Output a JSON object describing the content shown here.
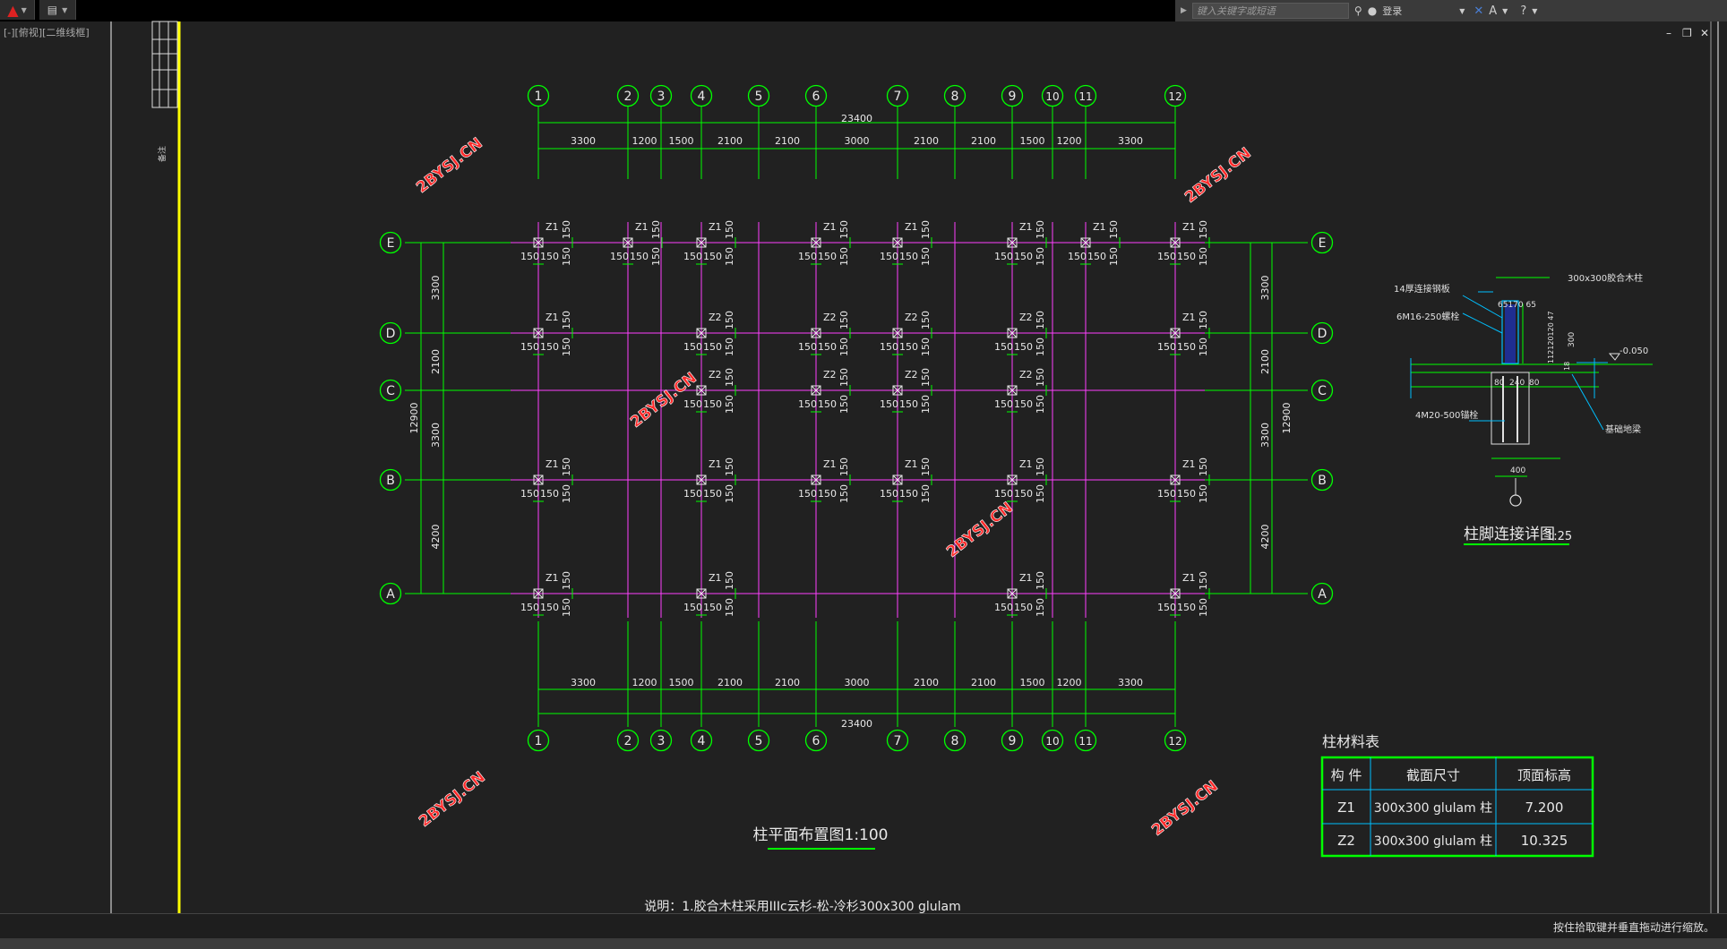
{
  "toolbar": {
    "search_placeholder": "键入关键字或短语",
    "login_label": "登录"
  },
  "viewport": {
    "label": "[-][俯视][二维线框]"
  },
  "status": {
    "hint": "按住拾取键并垂直拖动进行缩放。"
  },
  "sidebar": {
    "vertical_note": "备注"
  },
  "drawing": {
    "grid_x_labels": [
      "1",
      "2",
      "3",
      "4",
      "5",
      "6",
      "7",
      "8",
      "9",
      "10",
      "11",
      "12"
    ],
    "grid_y_labels": [
      "E",
      "D",
      "C",
      "B",
      "A"
    ],
    "top_total": "23400",
    "bottom_total": "23400",
    "x_spans": [
      "3300",
      "1200",
      "1500",
      "2100",
      "2100",
      "3000",
      "2100",
      "2100",
      "1500",
      "1200",
      "3300"
    ],
    "y_spans": [
      "3300",
      "2100",
      "3300",
      "4200"
    ],
    "y_total": "12900",
    "dim_150": "150",
    "col_z1": "Z1",
    "col_z2": "Z2",
    "watermark": "2BYSJ.CN",
    "main_title": "柱平面布置图1:100",
    "note": "说明：1.胶合木柱采用IIIc云杉-松-冷杉300x300 glulam"
  },
  "detail": {
    "title": "柱脚连接详图",
    "scale": "1:25",
    "label_col": "300x300胶合木柱",
    "label_plate": "14厚连接钢板",
    "label_bolt": "6M16-250螺栓",
    "label_anchor": "4M20-500锚栓",
    "label_beam": "基础地梁",
    "elev": "-0.050",
    "dims_top": "65170 65",
    "dim_80a": "80",
    "dim_240": "240",
    "dim_80b": "80",
    "dim_400": "400",
    "dim_300": "300",
    "dim_vert": "112120120 47",
    "dim_18": "18"
  },
  "table": {
    "title": "柱材料表",
    "headers": [
      "构 件",
      "截面尺寸",
      "顶面标高"
    ],
    "rows": [
      [
        "Z1",
        "300x300 glulam 柱",
        "7.200"
      ],
      [
        "Z2",
        "300x300 glulam 柱",
        "10.325"
      ]
    ]
  }
}
